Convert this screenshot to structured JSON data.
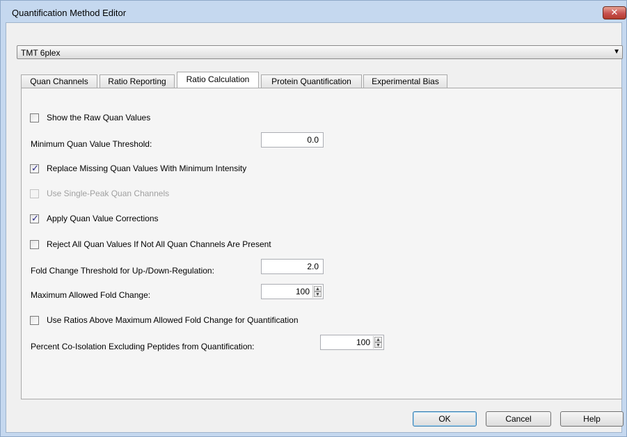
{
  "window": {
    "title": "Quantification Method Editor",
    "close_glyph": "✕"
  },
  "method_select": {
    "value": "TMT 6plex",
    "arrow": "▼"
  },
  "tabs": [
    {
      "label": "Quan Channels"
    },
    {
      "label": "Ratio Reporting"
    },
    {
      "label": "Ratio Calculation",
      "active": true
    },
    {
      "label": "Protein Quantification"
    },
    {
      "label": "Experimental Bias"
    }
  ],
  "settings": {
    "show_raw": {
      "label": "Show the Raw Quan Values",
      "checked": false
    },
    "min_threshold": {
      "label": "Minimum Quan Value Threshold:",
      "value": "0.0"
    },
    "replace_missing": {
      "label": "Replace Missing Quan Values With Minimum Intensity",
      "checked": true
    },
    "single_peak": {
      "label": "Use Single-Peak Quan Channels",
      "checked": false,
      "disabled": true
    },
    "apply_corrections": {
      "label": "Apply Quan Value Corrections",
      "checked": true
    },
    "reject_all": {
      "label": "Reject All Quan Values If Not All Quan Channels Are Present",
      "checked": false
    },
    "fold_threshold": {
      "label": "Fold Change Threshold for Up-/Down-Regulation:",
      "value": "2.0"
    },
    "max_fold": {
      "label": "Maximum Allowed Fold Change:",
      "value": "100"
    },
    "use_ratios_above": {
      "label": "Use Ratios Above Maximum Allowed Fold Change for Quantification",
      "checked": false
    },
    "co_isolation": {
      "label": "Percent Co-Isolation Excluding Peptides from Quantification:",
      "value": "100"
    }
  },
  "buttons": {
    "ok": "OK",
    "cancel": "Cancel",
    "help": "Help"
  },
  "icons": {
    "spin_up": "▲",
    "spin_down": "▼"
  }
}
